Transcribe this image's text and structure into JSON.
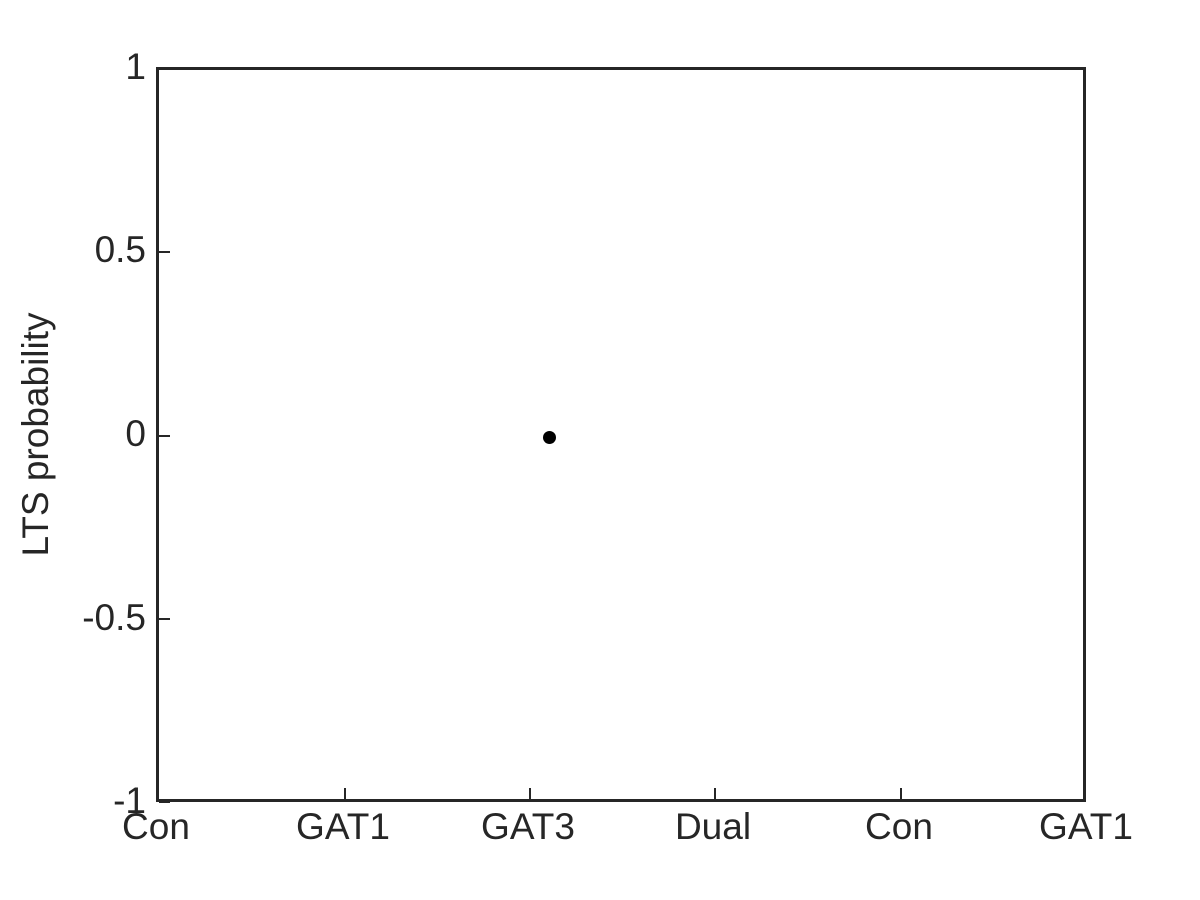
{
  "chart_data": {
    "type": "scatter",
    "title": "",
    "xlabel": "",
    "ylabel": "LTS probability",
    "xlim": [
      0,
      5
    ],
    "ylim": [
      -1,
      1
    ],
    "grid": false,
    "legend": null,
    "x_tick_labels": [
      "Con",
      "GAT1",
      "GAT3",
      "Dual",
      "Con",
      "GAT1"
    ],
    "x_tick_values": [
      0,
      1,
      2,
      3,
      4,
      5
    ],
    "y_tick_labels": [
      "1",
      "0.5",
      "0",
      "-0.5",
      "-1"
    ],
    "y_tick_values": [
      1,
      0.5,
      0,
      -0.5,
      -1
    ],
    "series": [
      {
        "name": "LTS probability",
        "marker": "circle",
        "color": "#000000",
        "points": [
          {
            "x": 2.1,
            "y": 0
          }
        ]
      }
    ]
  },
  "axes": {
    "border_color": "#262626",
    "background": "#ffffff"
  }
}
